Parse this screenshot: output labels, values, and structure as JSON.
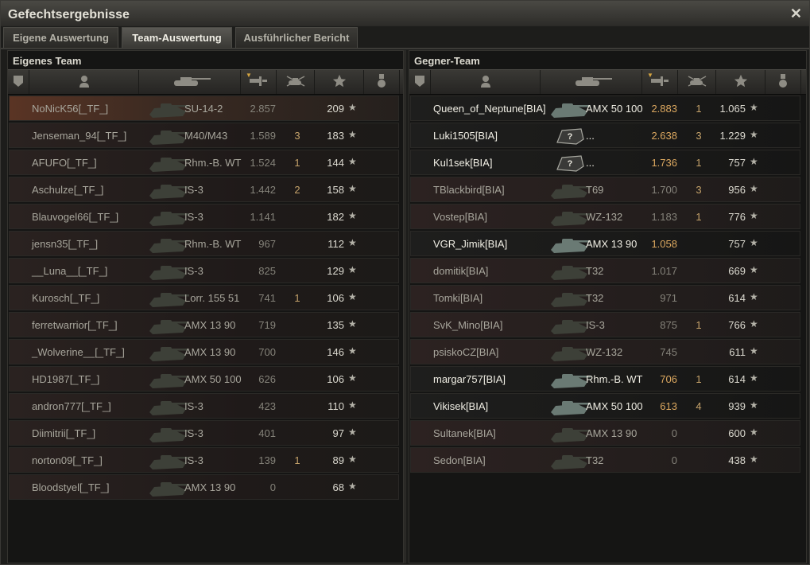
{
  "window": {
    "title": "Gefechtsergebnisse",
    "close_symbol": "✕"
  },
  "tabs": [
    {
      "label": "Eigene Auswertung",
      "active": false
    },
    {
      "label": "Team-Auswertung",
      "active": true
    },
    {
      "label": "Ausführlicher Bericht",
      "active": false
    }
  ],
  "own_team": {
    "title": "Eigenes Team",
    "players": [
      {
        "name": "NoNicK56[_TF_]",
        "vehicle": "SU-14-2",
        "damage": "2.857",
        "kills": "",
        "xp": "209",
        "highlight": "self"
      },
      {
        "name": "Jenseman_94[_TF_]",
        "vehicle": "M40/M43",
        "damage": "1.589",
        "kills": "3",
        "xp": "183"
      },
      {
        "name": "AFUFO[_TF_]",
        "vehicle": "Rhm.-B. WT",
        "damage": "1.524",
        "kills": "1",
        "xp": "144"
      },
      {
        "name": "Aschulze[_TF_]",
        "vehicle": "IS-3",
        "damage": "1.442",
        "kills": "2",
        "xp": "158"
      },
      {
        "name": "Blauvogel66[_TF_]",
        "vehicle": "IS-3",
        "damage": "1.141",
        "kills": "",
        "xp": "182"
      },
      {
        "name": "jensn35[_TF_]",
        "vehicle": "Rhm.-B. WT",
        "damage": "967",
        "kills": "",
        "xp": "112"
      },
      {
        "name": "__Luna__[_TF_]",
        "vehicle": "IS-3",
        "damage": "825",
        "kills": "",
        "xp": "129"
      },
      {
        "name": "Kurosch[_TF_]",
        "vehicle": "Lorr. 155 51",
        "damage": "741",
        "kills": "1",
        "xp": "106"
      },
      {
        "name": "ferretwarrior[_TF_]",
        "vehicle": "AMX 13 90",
        "damage": "719",
        "kills": "",
        "xp": "135"
      },
      {
        "name": "_Wolverine__[_TF_]",
        "vehicle": "AMX 13 90",
        "damage": "700",
        "kills": "",
        "xp": "146"
      },
      {
        "name": "HD1987[_TF_]",
        "vehicle": "AMX 50 100",
        "damage": "626",
        "kills": "",
        "xp": "106"
      },
      {
        "name": "andron777[_TF_]",
        "vehicle": "IS-3",
        "damage": "423",
        "kills": "",
        "xp": "110"
      },
      {
        "name": "Diimitrii[_TF_]",
        "vehicle": "IS-3",
        "damage": "401",
        "kills": "",
        "xp": "97"
      },
      {
        "name": "norton09[_TF_]",
        "vehicle": "IS-3",
        "damage": "139",
        "kills": "1",
        "xp": "89"
      },
      {
        "name": "Bloodstyel[_TF_]",
        "vehicle": "AMX 13 90",
        "damage": "0",
        "kills": "",
        "xp": "68"
      }
    ]
  },
  "enemy_team": {
    "title": "Gegner-Team",
    "players": [
      {
        "name": "Queen_of_Neptune[BIA]",
        "vehicle": "AMX 50 100",
        "damage": "2.883",
        "kills": "1",
        "xp": "1.065",
        "alive": true
      },
      {
        "name": "Luki1505[BIA]",
        "vehicle": "...",
        "damage": "2.638",
        "kills": "3",
        "xp": "1.229",
        "alive": true,
        "unknown": true
      },
      {
        "name": "Kul1sek[BIA]",
        "vehicle": "...",
        "damage": "1.736",
        "kills": "1",
        "xp": "757",
        "alive": true,
        "unknown": true
      },
      {
        "name": "TBlackbird[BIA]",
        "vehicle": "T69",
        "damage": "1.700",
        "kills": "3",
        "xp": "956",
        "alive": false
      },
      {
        "name": "Vostep[BIA]",
        "vehicle": "WZ-132",
        "damage": "1.183",
        "kills": "1",
        "xp": "776",
        "alive": false
      },
      {
        "name": "VGR_Jimik[BIA]",
        "vehicle": "AMX 13 90",
        "damage": "1.058",
        "kills": "",
        "xp": "757",
        "alive": true
      },
      {
        "name": "domitik[BIA]",
        "vehicle": "T32",
        "damage": "1.017",
        "kills": "",
        "xp": "669",
        "alive": false
      },
      {
        "name": "Tomki[BIA]",
        "vehicle": "T32",
        "damage": "971",
        "kills": "",
        "xp": "614",
        "alive": false
      },
      {
        "name": "SvK_Mino[BIA]",
        "vehicle": "IS-3",
        "damage": "875",
        "kills": "1",
        "xp": "766",
        "alive": false
      },
      {
        "name": "psiskoCZ[BIA]",
        "vehicle": "WZ-132",
        "damage": "745",
        "kills": "",
        "xp": "611",
        "alive": false
      },
      {
        "name": "margar757[BIA]",
        "vehicle": "Rhm.-B. WT",
        "damage": "706",
        "kills": "1",
        "xp": "614",
        "alive": true
      },
      {
        "name": "Vikisek[BIA]",
        "vehicle": "AMX 50 100",
        "damage": "613",
        "kills": "4",
        "xp": "939",
        "alive": true
      },
      {
        "name": "Sultanek[BIA]",
        "vehicle": "AMX 13 90",
        "damage": "0",
        "kills": "",
        "xp": "600",
        "alive": false
      },
      {
        "name": "Sedon[BIA]",
        "vehicle": "T32",
        "damage": "0",
        "kills": "",
        "xp": "438",
        "alive": false
      }
    ]
  },
  "icons": {
    "star": "★",
    "unknown_vehicle": "?"
  },
  "columns": [
    "platoon-icon",
    "player-icon",
    "tank-icon",
    "damage-icon",
    "kills-icon",
    "xp-star-icon",
    "medal-icon"
  ]
}
